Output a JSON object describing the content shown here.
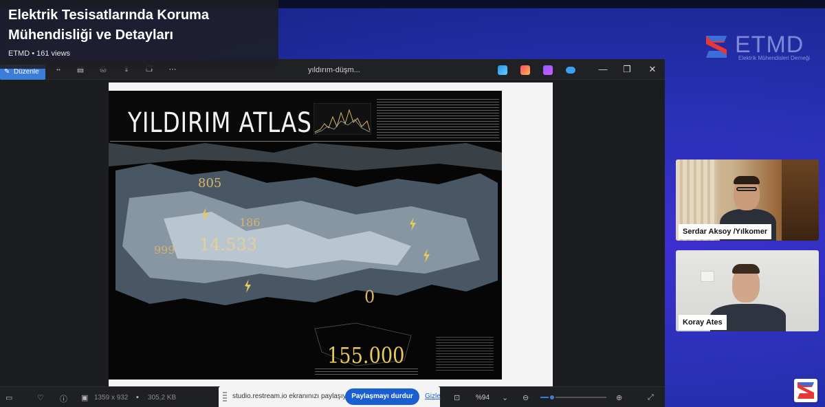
{
  "video": {
    "title": "Elektrik Tesisatlarında Koruma Mühendisliği ve Detayları",
    "meta": "ETMD • 161 views"
  },
  "brand": {
    "name": "ETMD",
    "subtitle": "Elektrik Mühendisleri Derneği"
  },
  "viewer": {
    "edit_label": "Düzenle",
    "file_title": "yıldırım-düşm...",
    "toolbar_icons": [
      "crop-icon",
      "paste-icon",
      "print-icon",
      "share-icon",
      "copy-icon",
      "more-icon"
    ],
    "app_icons": [
      "editor-app-icon",
      "paint-app-icon",
      "clipchamp-app-icon",
      "onedrive-icon"
    ]
  },
  "document": {
    "title": "YILDIRIM ATLASI",
    "big_number": "155.000",
    "map_numbers": [
      "805",
      "186",
      "14.533",
      "999",
      "0"
    ]
  },
  "status": {
    "dimensions": "1359 x 932",
    "file_size": "305,2 KB",
    "zoom": "%94",
    "zoom_level": 0.18
  },
  "share": {
    "message": "studio.restream.io ekranınızı paylaşıyor.",
    "stop_label": "Paylaşmayı durdur",
    "hide_label": "Gizle"
  },
  "participants": [
    {
      "name": "Serdar Aksoy /Yılkomer"
    },
    {
      "name": "Koray Ates"
    }
  ],
  "colors": {
    "brand_blue": "#3b7dd8",
    "brand_red": "#e53935",
    "share_button": "#1a5fd1",
    "map_accent": "#e8c95a"
  }
}
